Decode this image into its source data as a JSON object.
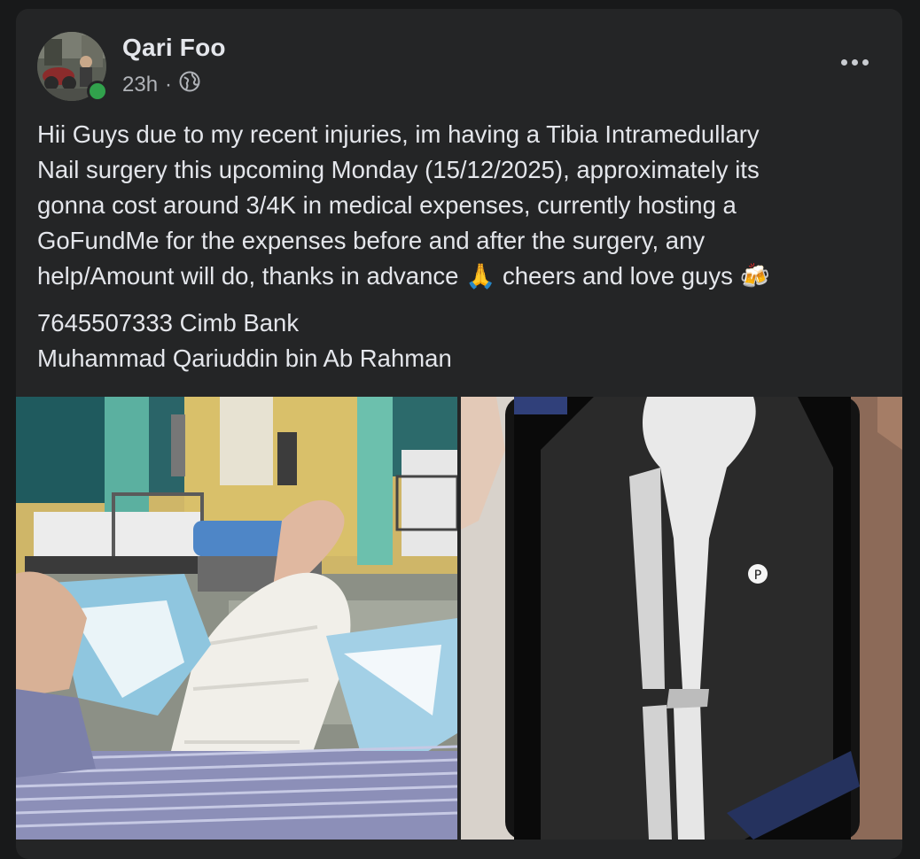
{
  "post": {
    "author": "Qari Foo",
    "time": "23h",
    "separator": "·",
    "audience_icon": "globe-icon",
    "more_icon": "more-options-icon",
    "text_lines": [
      "Hii Guys due to my recent injuries, im having a Tibia Intramedullary",
      "Nail  surgery this upcoming Monday (15/12/2025), approximately its",
      "gonna cost around 3/4K in medical expenses, currently hosting a",
      "GoFundMe for the expenses before and after the surgery, any",
      "help/Amount will do, thanks in advance 🙏 cheers and love guys 🍻"
    ],
    "bank_account": "7645507333 Cimb Bank",
    "account_name": "Muhammad Qariuddin bin Ab Rahman",
    "photos": [
      {
        "alt": "photo-hospital-leg"
      },
      {
        "alt": "photo-xray-phone"
      }
    ]
  },
  "colors": {
    "page_bg": "#18191a",
    "card_bg": "#242526",
    "text_primary": "#e4e6eb",
    "text_secondary": "#b0b3b8",
    "online": "#31a24c"
  }
}
